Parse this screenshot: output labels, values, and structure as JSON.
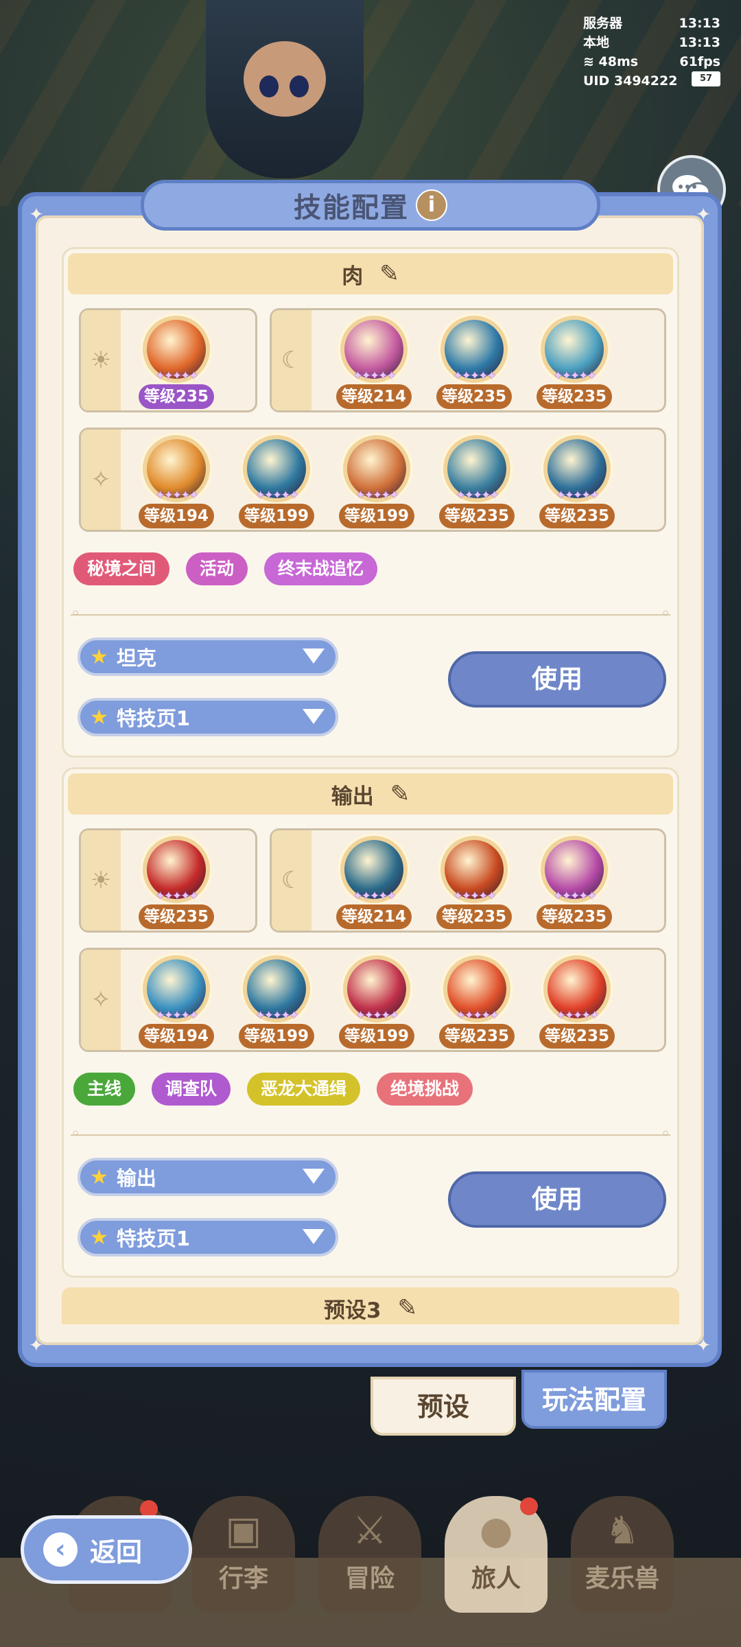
{
  "status": {
    "server_label": "服务器",
    "server_time": "13:13",
    "local_label": "本地",
    "local_time": "13:13",
    "ping": "48ms",
    "fps": "61fps",
    "uid": "UID 3494222",
    "battery": "57"
  },
  "panel": {
    "title": "技能配置",
    "info_icon": "i"
  },
  "presets": [
    {
      "name": "肉",
      "sun_skills": [
        {
          "level": "等级235",
          "color": "#e0662a",
          "lvl_style": "purple"
        }
      ],
      "moon_skills": [
        {
          "level": "等级214",
          "color": "#c45aa0"
        },
        {
          "level": "等级235",
          "color": "#2f7aa8"
        },
        {
          "level": "等级235",
          "color": "#4a9fc0"
        }
      ],
      "special_skills": [
        {
          "level": "等级194",
          "color": "#e08a2c"
        },
        {
          "level": "等级199",
          "color": "#2e78a0"
        },
        {
          "level": "等级199",
          "color": "#d0703a"
        },
        {
          "level": "等级235",
          "color": "#3a7fa0"
        },
        {
          "level": "等级235",
          "color": "#2e6f99"
        }
      ],
      "tags": [
        {
          "label": "秘境之间",
          "color": "#e05a78"
        },
        {
          "label": "活动",
          "color": "#cc5fc4"
        },
        {
          "label": "终末战追忆",
          "color": "#c768d6"
        }
      ],
      "dropdown_main": "坦克",
      "dropdown_page": "特技页1",
      "use_label": "使用"
    },
    {
      "name": "输出",
      "sun_skills": [
        {
          "level": "等级235",
          "color": "#c42a2a",
          "lvl_style": "brown"
        }
      ],
      "moon_skills": [
        {
          "level": "等级214",
          "color": "#2a6a8a"
        },
        {
          "level": "等级235",
          "color": "#c84a20"
        },
        {
          "level": "等级235",
          "color": "#b54aa8"
        }
      ],
      "special_skills": [
        {
          "level": "等级194",
          "color": "#3a90c0"
        },
        {
          "level": "等级199",
          "color": "#2e78a0"
        },
        {
          "level": "等级199",
          "color": "#c0304a"
        },
        {
          "level": "等级235",
          "color": "#e0502a"
        },
        {
          "level": "等级235",
          "color": "#e04028"
        }
      ],
      "tags": [
        {
          "label": "主线",
          "color": "#4aa83a"
        },
        {
          "label": "调查队",
          "color": "#b05ad0"
        },
        {
          "label": "恶龙大通缉",
          "color": "#d4c22a"
        },
        {
          "label": "绝境挑战",
          "color": "#e8727a"
        }
      ],
      "dropdown_main": "输出",
      "dropdown_page": "特技页1",
      "use_label": "使用"
    }
  ],
  "preset3_name": "预设3",
  "tabs": {
    "preset": "预设",
    "gameplay": "玩法配置"
  },
  "nav": {
    "back": "返回",
    "items": [
      "行李",
      "冒险",
      "旅人",
      "麦乐兽"
    ]
  },
  "icons": {
    "sun": "sun-icon",
    "moon": "moon-icon",
    "sparkle": "sparkle-icon",
    "edit": "edit-icon",
    "chat": "chat-icon"
  }
}
